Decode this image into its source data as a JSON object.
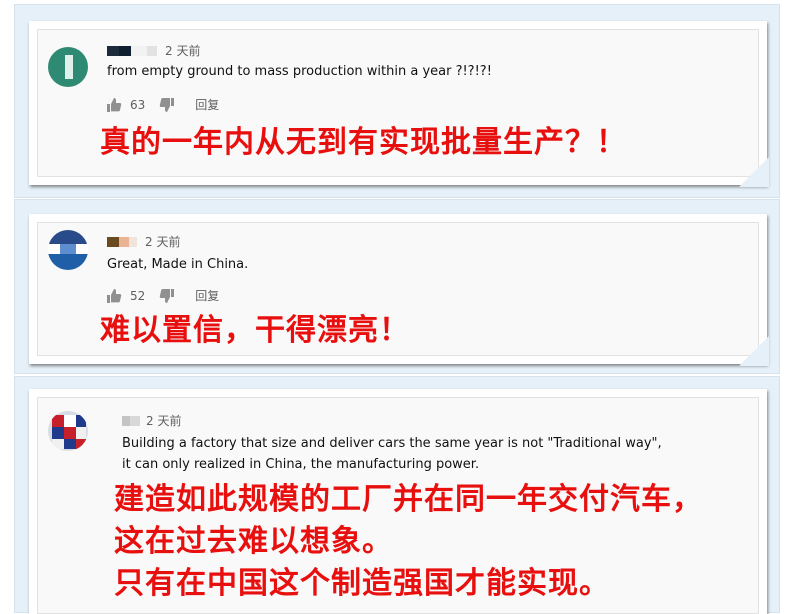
{
  "comments": [
    {
      "time": "2 天前",
      "text": "from empty ground to mass production within a year ?!?!?!",
      "likes": "63",
      "reply_label": "回复",
      "translation_lines": [
        "真的一年内从无到有实现批量生产？！"
      ]
    },
    {
      "time": "2 天前",
      "text": "Great, Made in China.",
      "likes": "52",
      "reply_label": "回复",
      "translation_lines": [
        "难以置信，干得漂亮！"
      ]
    },
    {
      "time": "2 天前",
      "text_lines": [
        "Building a factory that size and deliver cars the same year is not \"Traditional way\",",
        "it can only realized in China, the manufacturing power."
      ],
      "translation_lines": [
        "建造如此规模的工厂并在同一年交付汽车，",
        "这在过去难以想象。",
        "只有在中国这个制造强国才能实现。"
      ]
    }
  ],
  "colors": {
    "translation": "#e8100e",
    "panel_bg": "#e6f0f8",
    "meta": "#606060"
  },
  "icons": [
    "thumbs-up-icon",
    "thumbs-down-icon"
  ]
}
